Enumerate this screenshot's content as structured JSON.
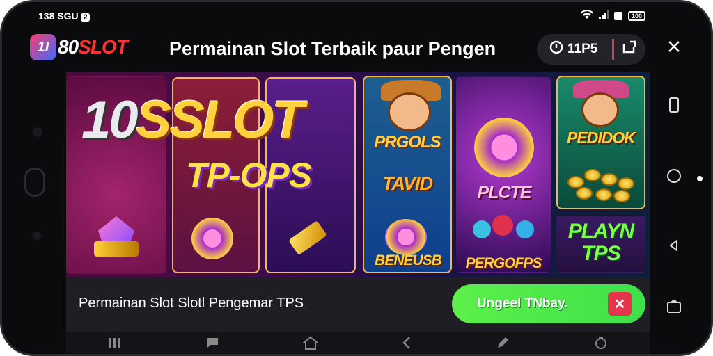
{
  "statusbar": {
    "time": "138 SGU",
    "notification_count": "2",
    "battery": "100"
  },
  "header": {
    "logo_badge": "1I",
    "logo_text": "80SLOT",
    "title": "Permainan Slot Terbaik paur Pengen",
    "counter": "11P5",
    "accent": "#e23a4c"
  },
  "banner": {
    "big_num": "10",
    "big_word": "SSLOT",
    "subtitle": "TP-OPS",
    "labels": {
      "l1": "PRGOLS",
      "l2": "TAVID",
      "l3": "BENEUSB",
      "l4": "PLCTE",
      "l5": "PERGOFPS",
      "l6": "PEDIDOK",
      "l7": "PLAYN TPS"
    }
  },
  "footer": {
    "text": "Permainan Slot Slotl Pengemar TPS",
    "cta_label": "Ungeel TNbay.",
    "cta_color": "#3fe04a"
  },
  "icons": {
    "wifi": "wifi-icon",
    "signal": "signal-icon",
    "battery": "battery-icon",
    "share": "share-icon",
    "close": "close-icon",
    "timer": "timer-icon"
  }
}
